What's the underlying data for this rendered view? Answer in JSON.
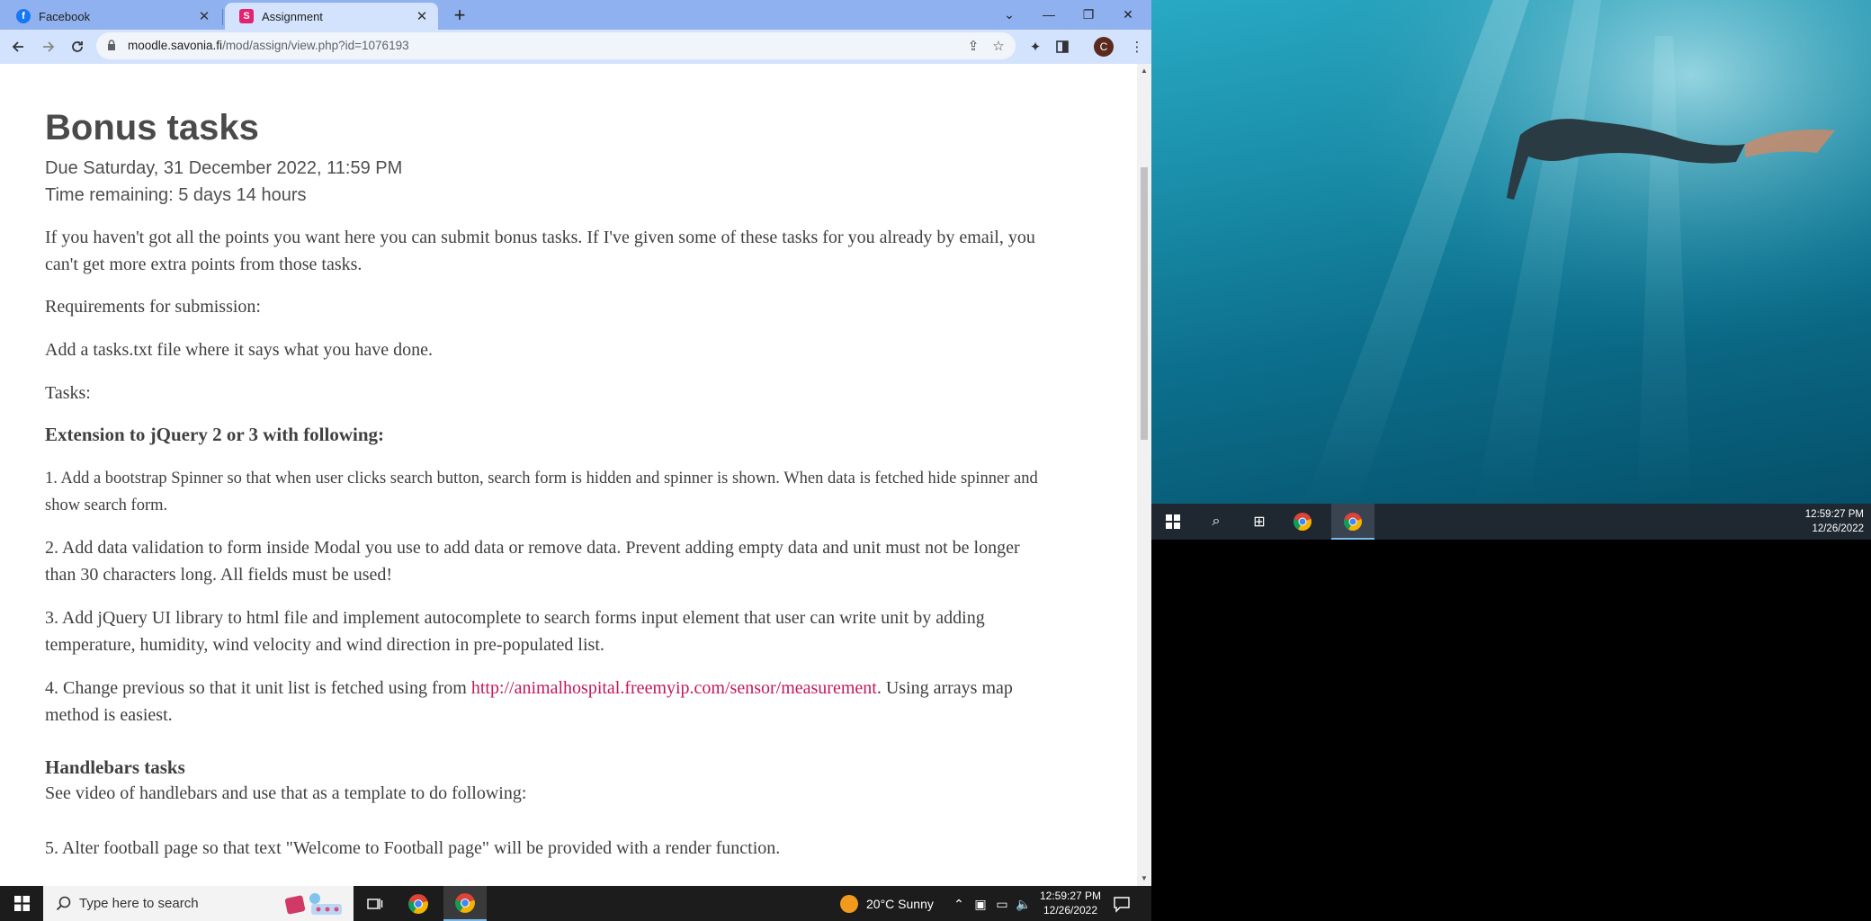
{
  "browser": {
    "tabs": [
      {
        "label": "Facebook",
        "favicon": "facebook-icon"
      },
      {
        "label": "Assignment",
        "favicon": "s-icon"
      }
    ],
    "url_domain": "moodle.savonia.fi",
    "url_path": "/mod/assign/view.php?id=1076193",
    "profile_initial": "C"
  },
  "page": {
    "title": "Bonus tasks",
    "due": "Due Saturday, 31 December 2022, 11:59 PM",
    "remaining": "Time remaining: 5 days 14 hours",
    "intro": "If you haven't got all the points you want here you can submit bonus tasks. If I've given some of these tasks for you already by email, you can't get more extra points from those tasks.",
    "requirements_label": "Requirements for submission:",
    "requirement": "Add a tasks.txt file where it says what you have done.",
    "tasks_label": "Tasks:",
    "section1_heading": "Extension to jQuery 2 or 3 with following:",
    "task1": "1. Add a bootstrap Spinner so that when user clicks search button, search form is hidden and spinner is shown. When data is fetched hide spinner and show search form.",
    "task2": "2. Add data validation to form inside Modal you use to add data or remove data. Prevent adding empty data and unit must not be longer than 30 characters long. All fields must be used!",
    "task3": "3. Add jQuery UI library to html file and implement autocomplete to search forms input element that user can write unit by adding temperature, humidity, wind velocity and wind direction in pre-populated list.",
    "task4_before": "4. Change previous so that it unit list is fetched using from ",
    "task4_link": "http://animalhospital.freemyip.com/sensor/measurement",
    "task4_after": ". Using arrays map method is easiest.",
    "section2_heading": "Handlebars tasks",
    "section2_intro": "See video of handlebars and use that as a template to do following:",
    "task5": "5. Alter football page so that text \"Welcome to Football page\" will be provided with a render function."
  },
  "taskbar": {
    "search_placeholder": "Type here to search",
    "weather": "20°C  Sunny",
    "time": "12:59:27 PM",
    "date": "12/26/2022"
  },
  "preview_taskbar": {
    "time": "12:59:27 PM",
    "date": "12/26/2022"
  }
}
